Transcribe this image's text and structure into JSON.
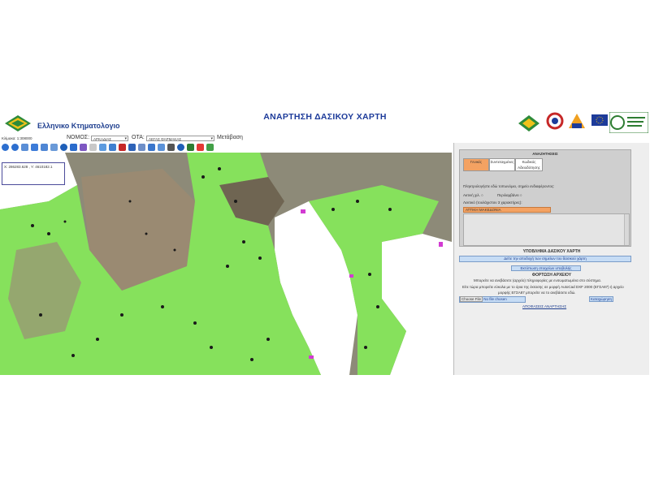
{
  "header": {
    "logo_text": "Ελληνικο Κτηματολογιο",
    "title": "ΑΝΑΡΤΗΣΗ ΔΑΣΙΚΟΥ ΧΑΡΤΗ"
  },
  "toolbar": {
    "scale_text": "Κλίμακα: 1:308000",
    "nomos_label": "ΝΟΜΟΣ:",
    "nomos_value": "ΑΡΚΑΔΙΑΣ",
    "ota_label": "ΟΤΑ:",
    "ota_value": "ΛΕΓΑΣ ΦΑΡΜΑΚΑΣ",
    "go_label": "Μετάβαση"
  },
  "map": {
    "coords_text": "X: 286283.628 , Y: 4610182.1"
  },
  "panel": {
    "search_title": "ΑΝΑΖΗΤΗΣΕΙΣ",
    "tabs": [
      "Γενικές",
      "Συντεταγμένες",
      "Κωδικός\nΑδειοδότησης"
    ],
    "hint": "Πληκτρολογήστε εδώ τοπωνύμιο, σημείο ενδιαφέροντος:",
    "radio_1": "Ακτινή χιλ.",
    "radio_2": "Περιλαμβάνει",
    "hint2": "Λεκτικό (τουλάχιστον 3 χαρακτήρες):",
    "input_value": "ΑΤΤΙΚΗ ΜΑΚΕΔΟΝΙΑ",
    "submission_title": "ΥΠΟΒΛΗΜΑ ΔΑΣΙΚΟΥ ΧΑΡΤΗ",
    "view_button": "Δείτε την αποδοχή των σημείων του δασικού χάρτη",
    "link_button": "Εκτύπωση στοιχείων υποβολής",
    "upload_title": "ΦΟΡΤΩΣΗ ΑΡΧΕΙΟΥ",
    "upload_line1": "Μπορείτε να ανεβάσετε (αρχείο) πληροφορίες με ενσωματωμένα στο σύστημα.",
    "upload_line2": "Είτε τώρα μπορείτε εύκολα με το όρια της έκτασης σε μορφή AutoCad DXF 2000 (ΕΓΣΑ87) ή αρχείο",
    "upload_line3": "μορφής ΕΓΣΑ87 μπορείτε να το ανεβάσετε εδώ.",
    "choose_file": "Choose File",
    "no_file": "No file chosen",
    "upload_button": "Καταχώρηση",
    "decision_link": "ΑΠΟΦΑΣΕΙΣ ΑΝΑΡΤΗΣΗΣ"
  },
  "colors": {
    "accent": "#1d3b9a",
    "forest": "#86e85a",
    "tab_active": "#f4a262",
    "input_bg": "#f4a262"
  }
}
